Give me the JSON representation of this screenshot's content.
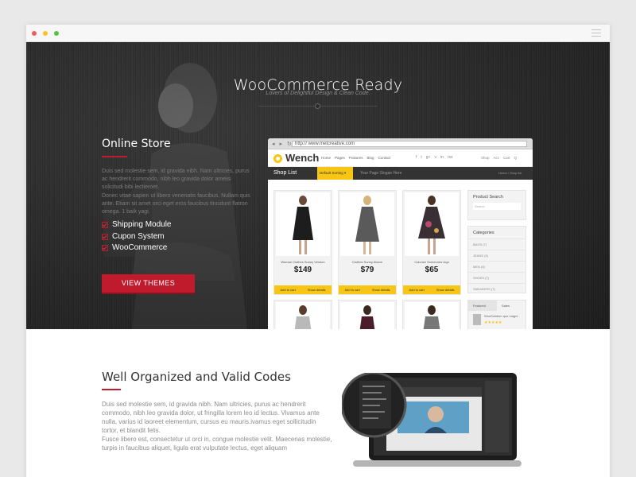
{
  "window": {
    "dots": [
      "#ee5f5b",
      "#f7c22e",
      "#59c241"
    ]
  },
  "hero": {
    "title": "WooCommerce Ready",
    "subtitle": "Lovers of Delightful Design & Clean Code."
  },
  "online_store": {
    "title": "Online Store",
    "para1": "Duis sed molestie sem, id gravida nibh. Nam ultricies, purus ac hendrerit commodo, nibh leo gravida dolor ameisi solicitudi bibi lectieroet.",
    "para2": "Donec vitae sapien ut libero venenatis faucibus. Nullam quis ante. Etiam sit amet orci eget eros faucibus tincidunt flatron omega. 1 baik yagi.",
    "features": [
      "Shipping Module",
      "Cupon System",
      "WooCommerce"
    ],
    "button": "VIEW THEMES"
  },
  "mock": {
    "nav": "◂ ▸ ↻",
    "url": "http:// www.metcreative.com",
    "brand": "Wench",
    "menu": [
      "Home",
      "Pages",
      "Features",
      "Blog",
      "Contact"
    ],
    "social": [
      "f",
      "t",
      "g+",
      "v",
      "in",
      "rss"
    ],
    "right": [
      "Shop",
      "Acc",
      "Cart",
      "Q"
    ],
    "shop_list": "Shop List",
    "sort": "Default Sorting ▾",
    "breadcrumb": "Your Page Slogan Here",
    "showing": "Home / Shop list",
    "products": [
      {
        "name": "Woman Clothes Sunny Version",
        "price": "$149",
        "cart": "Add to cart",
        "details": "Show details"
      },
      {
        "name": "Clothes Sunny Above",
        "price": "$79",
        "cart": "Add to cart",
        "details": "Show details"
      },
      {
        "name": "Colorize Someones Uqa",
        "price": "$65",
        "cart": "Add to cart",
        "details": "Show details"
      }
    ],
    "product_search": "Product Search",
    "search_placeholder": "Search",
    "categories_title": "Categories",
    "categories": [
      "BAGS (7)",
      "JEANS (4)",
      "MEN (6)",
      "SHOES (7)",
      "SNEAKERS (7)"
    ],
    "tabs": [
      "Featured",
      "Sales"
    ],
    "featured_item": "WooSolution quo magni",
    "stars": "★★★★★"
  },
  "section2": {
    "title": "Well Organized and Valid Codes",
    "para1": "Duis sed molestie sem, id gravida nibh. Nam ultricies, purus ac hendrerit commodo, nibh leo gravida dolor, ut fringilla lorem leo id lectus. Vivamus ante nulla, varius id laoreet elementum, cursus eu mauris.ivamus eget sollicitudin tortor, et blandit felis.",
    "para2": "Fusce libero est, consectetur ut orci in, congue molestie velit. Maecenas molestie, turpis in faucibus aliquet, ligula erat vulputate lectus, eget aliquam"
  },
  "colors": {
    "accent": "#c01b2c",
    "yellow": "#f7c513",
    "dark": "#2a2a2a"
  }
}
